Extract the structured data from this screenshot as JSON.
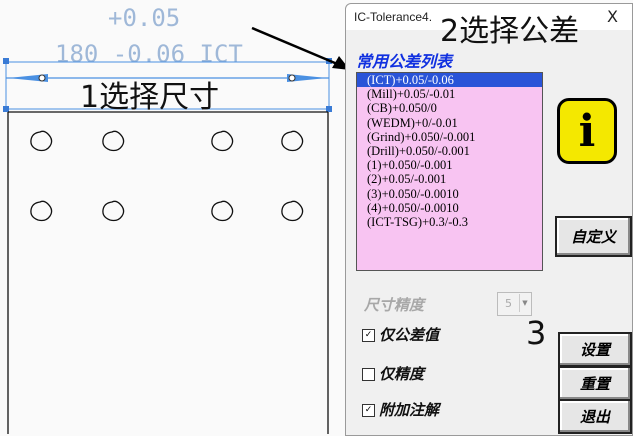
{
  "drawing": {
    "tolerance_upper": "+0.05",
    "dimension_text": "180 -0.06 ICT",
    "annotation_1": "1选择尺寸",
    "annotation_2": "2选择公差",
    "annotation_3": "3"
  },
  "dialog": {
    "title": "IC-Tolerance4.",
    "close": "X",
    "group_title": "常用公差列表",
    "tolerance_list": [
      "(ICT)+0.05/-0.06",
      "(Mill)+0.05/-0.01",
      "(CB)+0.050/0",
      "(WEDM)+0/-0.01",
      "(Grind)+0.050/-0.001",
      "(Drill)+0.050/-0.001",
      "(1)+0.050/-0.001",
      "(2)+0.05/-0.001",
      "(3)+0.050/-0.0010",
      "(4)+0.050/-0.0010",
      "(ICT-TSG)+0.3/-0.3"
    ],
    "selected_index": 0,
    "info_icon_letter": "i",
    "custom_button": "自定义",
    "precision_label": "尺寸精度",
    "precision_value": "5",
    "checkboxes": [
      {
        "label": "仅公差值",
        "checked": true
      },
      {
        "label": "仅精度",
        "checked": false
      },
      {
        "label": "附加注解",
        "checked": true
      }
    ],
    "buttons": {
      "set": "设置",
      "reset": "重置",
      "exit": "退出"
    }
  },
  "colors": {
    "list_bg": "#f8c4f2",
    "list_selected": "#2a54d8",
    "group_title": "#1030e0",
    "info_icon": "#f4e800",
    "dimension_text": "#9fb8d8",
    "dimension_line": "#4a90e2"
  }
}
